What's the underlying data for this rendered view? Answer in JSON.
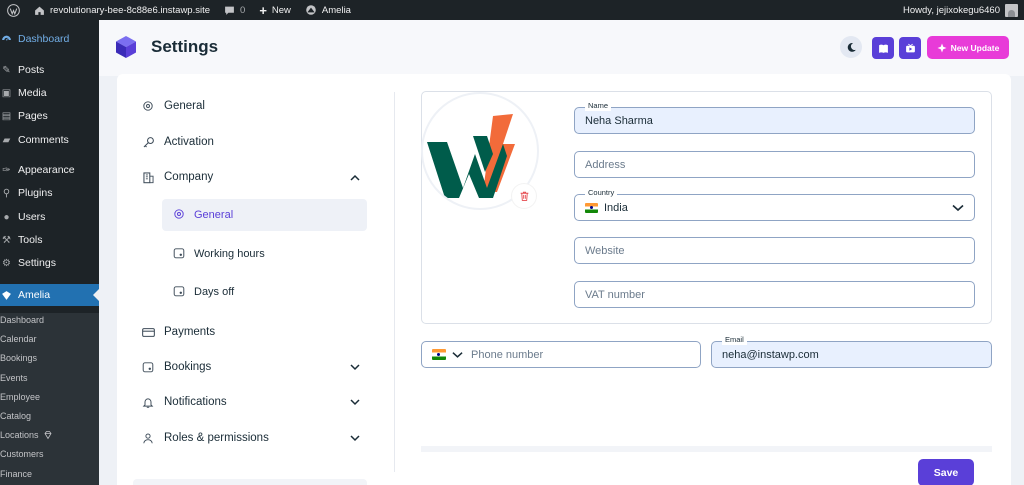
{
  "adminbar": {
    "site_name": "revolutionary-bee-8c88e6.instawp.site",
    "comments_count": "0",
    "new_label": "New",
    "plugin_label": "Amelia",
    "howdy": "Howdy, jejixokegu6460"
  },
  "wp_menu": {
    "items": [
      {
        "label": "Dashboard",
        "icon": "dashboard-icon"
      },
      {
        "label": "Posts",
        "icon": "pin-icon"
      },
      {
        "label": "Media",
        "icon": "media-icon"
      },
      {
        "label": "Pages",
        "icon": "page-icon"
      },
      {
        "label": "Comments",
        "icon": "comment-icon"
      },
      {
        "label": "Appearance",
        "icon": "brush-icon"
      },
      {
        "label": "Plugins",
        "icon": "plugin-icon"
      },
      {
        "label": "Users",
        "icon": "user-icon"
      },
      {
        "label": "Tools",
        "icon": "wrench-icon"
      },
      {
        "label": "Settings",
        "icon": "settings-icon"
      },
      {
        "label": "Amelia",
        "icon": "amelia-icon"
      }
    ],
    "submenu": [
      "Dashboard",
      "Calendar",
      "Bookings",
      "Events",
      "Employee",
      "Catalog",
      "Locations",
      "Customers",
      "Finance"
    ]
  },
  "header": {
    "title": "Settings",
    "new_update_label": "New Update"
  },
  "settings_menu": {
    "general": "General",
    "activation": "Activation",
    "company": "Company",
    "company_sub": [
      "General",
      "Working hours",
      "Days off"
    ],
    "payments": "Payments",
    "bookings": "Bookings",
    "notifications": "Notifications",
    "roles": "Roles & permissions"
  },
  "form": {
    "name_label": "Name",
    "name_value": "Neha Sharma",
    "address_placeholder": "Address",
    "country_label": "Country",
    "country_value": "India",
    "website_placeholder": "Website",
    "vat_placeholder": "VAT number",
    "phone_placeholder": "Phone number",
    "email_label": "Email",
    "email_value": "neha@instawp.com"
  },
  "save_label": "Save",
  "colors": {
    "accent": "#5a3fd8",
    "new_update": "#e83bd8",
    "wp_active": "#2271b1",
    "logo_green": "#005c4b",
    "logo_orange": "#f26b3a"
  }
}
